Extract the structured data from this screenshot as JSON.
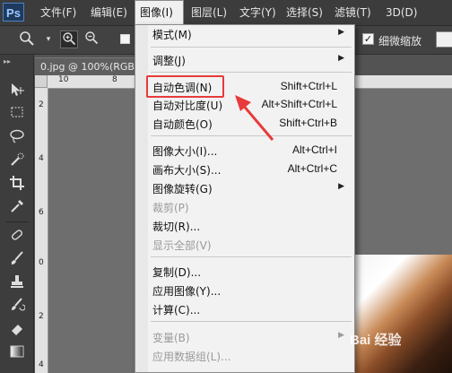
{
  "app": {
    "logo": "Ps"
  },
  "menubar": {
    "items": [
      {
        "label": "文件(F)"
      },
      {
        "label": "编辑(E)"
      },
      {
        "label": "图像(I)"
      },
      {
        "label": "图层(L)"
      },
      {
        "label": "文字(Y)"
      },
      {
        "label": "选择(S)"
      },
      {
        "label": "滤镜(T)"
      },
      {
        "label": "3D(D)"
      }
    ],
    "active_index": 2
  },
  "options_bar": {
    "zoom_tool_icon": "magnifier-icon",
    "zoom_in_icon": "zoom-in-icon",
    "zoom_out_icon": "zoom-out-icon",
    "scrubby_zoom_label": "细微缩放",
    "scrubby_zoom_checked": true
  },
  "document": {
    "tab_title": "0.jpg @ 100%(RGB",
    "hruler_numbers": [
      "10",
      "8"
    ],
    "vruler_numbers": [
      "2",
      "4",
      "6",
      "0",
      "2",
      "4"
    ]
  },
  "image_menu": {
    "items": [
      {
        "label": "模式(M)",
        "shortcut": "",
        "submenu": true,
        "disabled": false
      },
      {
        "sep": true
      },
      {
        "label": "调整(J)",
        "shortcut": "",
        "submenu": true,
        "disabled": false
      },
      {
        "sep": true
      },
      {
        "label": "自动色调(N)",
        "shortcut": "Shift+Ctrl+L",
        "submenu": false,
        "disabled": false
      },
      {
        "label": "自动对比度(U)",
        "shortcut": "Alt+Shift+Ctrl+L",
        "submenu": false,
        "disabled": false
      },
      {
        "label": "自动颜色(O)",
        "shortcut": "Shift+Ctrl+B",
        "submenu": false,
        "disabled": false
      },
      {
        "sep": true
      },
      {
        "label": "图像大小(I)...",
        "shortcut": "Alt+Ctrl+I",
        "submenu": false,
        "disabled": false
      },
      {
        "label": "画布大小(S)...",
        "shortcut": "Alt+Ctrl+C",
        "submenu": false,
        "disabled": false
      },
      {
        "label": "图像旋转(G)",
        "shortcut": "",
        "submenu": true,
        "disabled": false
      },
      {
        "label": "裁剪(P)",
        "shortcut": "",
        "submenu": false,
        "disabled": true
      },
      {
        "label": "裁切(R)...",
        "shortcut": "",
        "submenu": false,
        "disabled": false
      },
      {
        "label": "显示全部(V)",
        "shortcut": "",
        "submenu": false,
        "disabled": true
      },
      {
        "sep": true
      },
      {
        "label": "复制(D)...",
        "shortcut": "",
        "submenu": false,
        "disabled": false
      },
      {
        "label": "应用图像(Y)...",
        "shortcut": "",
        "submenu": false,
        "disabled": false
      },
      {
        "label": "计算(C)...",
        "shortcut": "",
        "submenu": false,
        "disabled": false
      },
      {
        "sep": true
      },
      {
        "label": "变量(B)",
        "shortcut": "",
        "submenu": true,
        "disabled": true
      },
      {
        "label": "应用数据组(L)...",
        "shortcut": "",
        "submenu": false,
        "disabled": true
      }
    ],
    "highlighted_label": "自动色调(N)"
  },
  "annotation": {
    "color": "#e83a3a"
  },
  "watermark": {
    "text": "Bai 经验"
  }
}
